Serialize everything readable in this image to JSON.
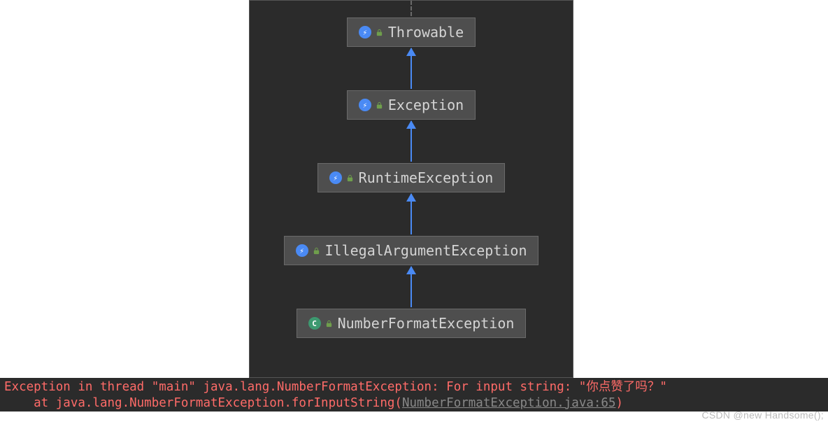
{
  "hierarchy": {
    "nodes": [
      {
        "label": "Throwable",
        "icon": "class",
        "glyph": "⚡"
      },
      {
        "label": "Exception",
        "icon": "class",
        "glyph": "⚡"
      },
      {
        "label": "RuntimeException",
        "icon": "class",
        "glyph": "⚡"
      },
      {
        "label": "IllegalArgumentException",
        "icon": "class",
        "glyph": "⚡"
      },
      {
        "label": "NumberFormatException",
        "icon": "class-final",
        "glyph": "C"
      }
    ]
  },
  "stacktrace": {
    "line1_prefix": "Exception in thread \"main\" java.lang.NumberFormatException: For input string: \"",
    "line1_input": "你点赞了吗？",
    "line1_suffix": "\"",
    "line2_prefix": "    at java.lang.NumberFormatException.forInputString(",
    "line2_link": "NumberFormatException.java:65",
    "line2_suffix": ")"
  },
  "watermark": "CSDN @new Handsome();"
}
